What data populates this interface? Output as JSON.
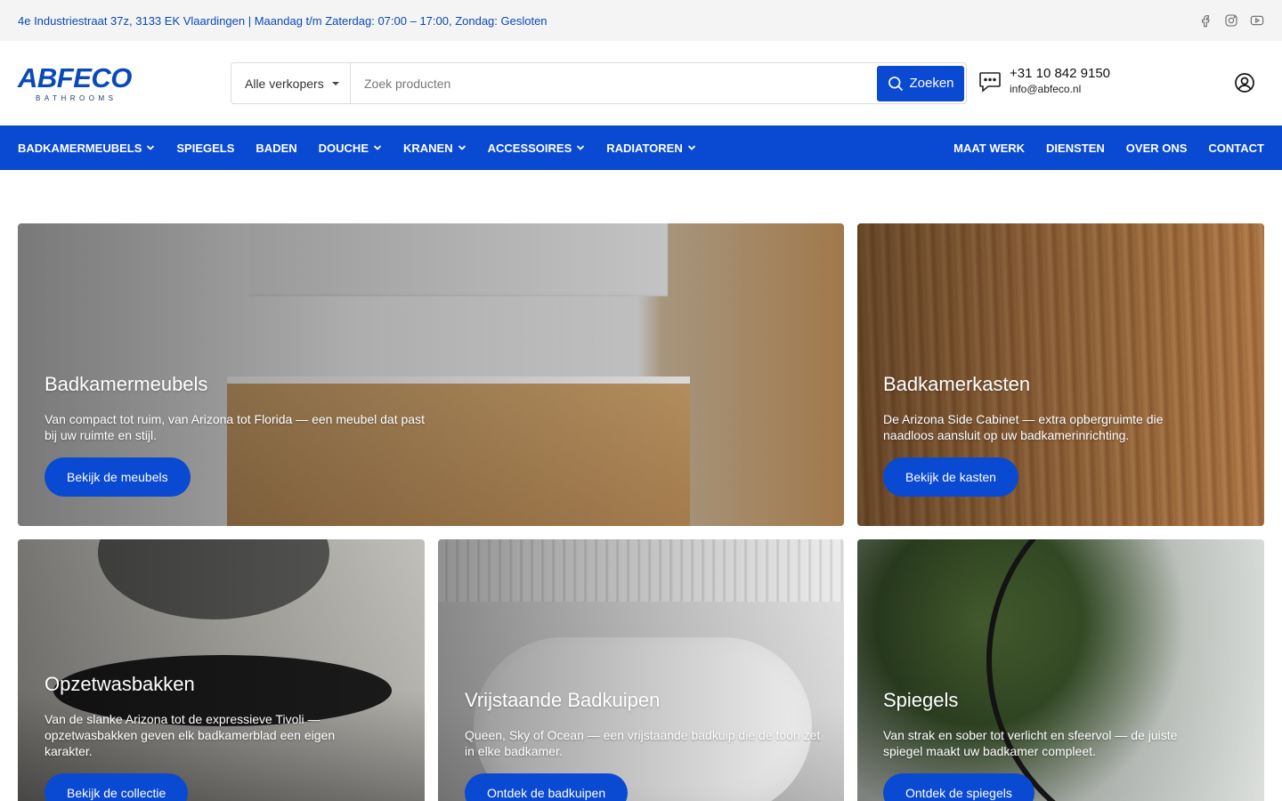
{
  "topbar": {
    "address": "4e Industriestraat 37z, 3133 EK Vlaardingen | Maandag t/m Zaterdag: 07:00 – 17:00, Zondag: Gesloten",
    "social": [
      "facebook-icon",
      "instagram-icon",
      "youtube-icon"
    ]
  },
  "logo": {
    "word": "ABFECO",
    "sub": "BATHROOMS"
  },
  "search": {
    "vendor_label": "Alle verkopers",
    "placeholder": "Zoek producten",
    "button_label": "Zoeken"
  },
  "contact": {
    "phone": "+31 10 842 9150",
    "email": "info@abfeco.nl"
  },
  "nav": {
    "left": [
      {
        "label": "BADKAMERMEUBELS",
        "has_dropdown": true
      },
      {
        "label": "SPIEGELS",
        "has_dropdown": false
      },
      {
        "label": "BADEN",
        "has_dropdown": false
      },
      {
        "label": "DOUCHE",
        "has_dropdown": true
      },
      {
        "label": "KRANEN",
        "has_dropdown": true
      },
      {
        "label": "ACCESSOIRES",
        "has_dropdown": true
      },
      {
        "label": "RADIATOREN",
        "has_dropdown": true
      }
    ],
    "right": [
      {
        "label": "MAAT WERK"
      },
      {
        "label": "DIENSTEN"
      },
      {
        "label": "OVER ONS"
      },
      {
        "label": "CONTACT"
      }
    ]
  },
  "cards": [
    {
      "title": "Badkamermeubels",
      "text": "Van compact tot ruim, van Arizona tot Florida — een meubel dat past bij uw ruimte en stijl.",
      "cta": "Bekijk de meubels"
    },
    {
      "title": "Badkamerkasten",
      "text": "De Arizona Side Cabinet — extra opbergruimte die naadloos aansluit op uw badkamerinrichting.",
      "cta": "Bekijk de kasten"
    },
    {
      "title": "Opzetwasbakken",
      "text": "Van de slanke Arizona tot de expressieve Tivoli — opzetwasbakken geven elk badkamerblad een eigen karakter.",
      "cta": "Bekijk de collectie"
    },
    {
      "title": "Vrijstaande Badkuipen",
      "text": "Queen, Sky of Ocean — een vrijstaande badkuip die de toon zet in elke badkamer.",
      "cta": "Ontdek de badkuipen"
    },
    {
      "title": "Spiegels",
      "text": "Van strak en sober tot verlicht en sfeervol — de juiste spiegel maakt uw badkamer compleet.",
      "cta": "Ontdek de spiegels"
    }
  ],
  "colors": {
    "brand_blue": "#0a49d1",
    "address_blue": "#0a49b8",
    "topbar_bg": "#f4f4f5"
  }
}
